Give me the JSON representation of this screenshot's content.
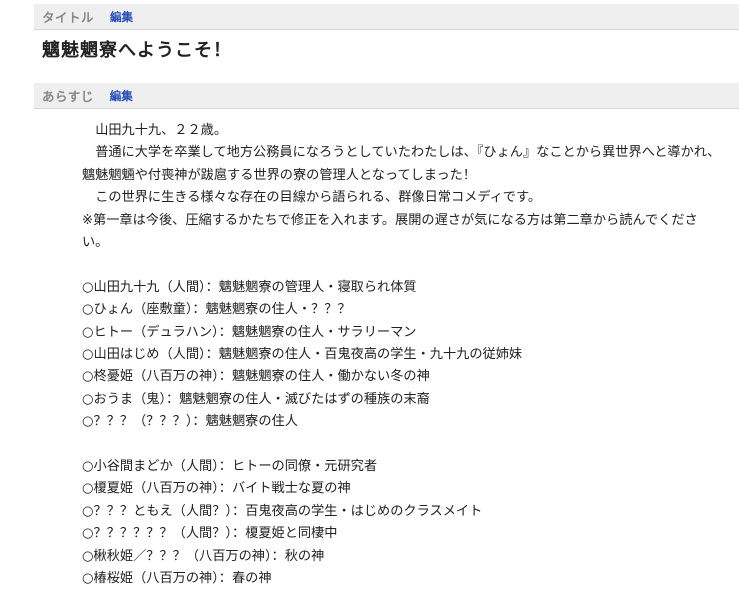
{
  "title_section": {
    "label": "タイトル",
    "edit_label": "編集",
    "title": "魑魅魍寮へようこそ！"
  },
  "synopsis_section": {
    "label": "あらすじ",
    "edit_label": "編集",
    "paragraphs": [
      "山田九十九、２２歳。",
      "普通に大学を卒業して地方公務員になろうとしていたわたしは、『ひょん』なことから異世界へと導かれ、魑魅魍魎や付喪神が跋扈する世界の寮の管理人となってしまった！",
      "この世界に生きる様々な存在の目線から語られる、群像日常コメディです。",
      "※第一章は今後、圧縮するかたちで修正を入れます。展開の遅さが気になる方は第二章から読んでください。"
    ],
    "characters_group1": [
      "○山田九十九（人間）：魑魅魍寮の管理人・寝取られ体質",
      "○ひょん（座敷童）：魑魅魍寮の住人・？？？",
      "○ヒトー（デュラハン）：魑魅魍寮の住人・サラリーマン",
      "○山田はじめ（人間）：魑魅魍寮の住人・百鬼夜高の学生・九十九の従姉妹",
      "○柊憂姫（八百万の神）：魑魅魍寮の住人・働かない冬の神",
      "○おうま（鬼）：魑魅魍寮の住人・滅びたはずの種族の末裔",
      "○？？？（？？？）：魑魅魍寮の住人"
    ],
    "characters_group2": [
      "○小谷間まどか（人間）：ヒトーの同僚・元研究者",
      "○榎夏姫（八百万の神）：バイト戦士な夏の神",
      "○？？？ともえ（人間？）：百鬼夜高の学生・はじめのクラスメイト",
      "○？？？？？？（人間？）：榎夏姫と同棲中",
      "○楸秋姫／？？？（八百万の神）：秋の神",
      "○椿桜姫（八百万の神）：春の神"
    ]
  }
}
